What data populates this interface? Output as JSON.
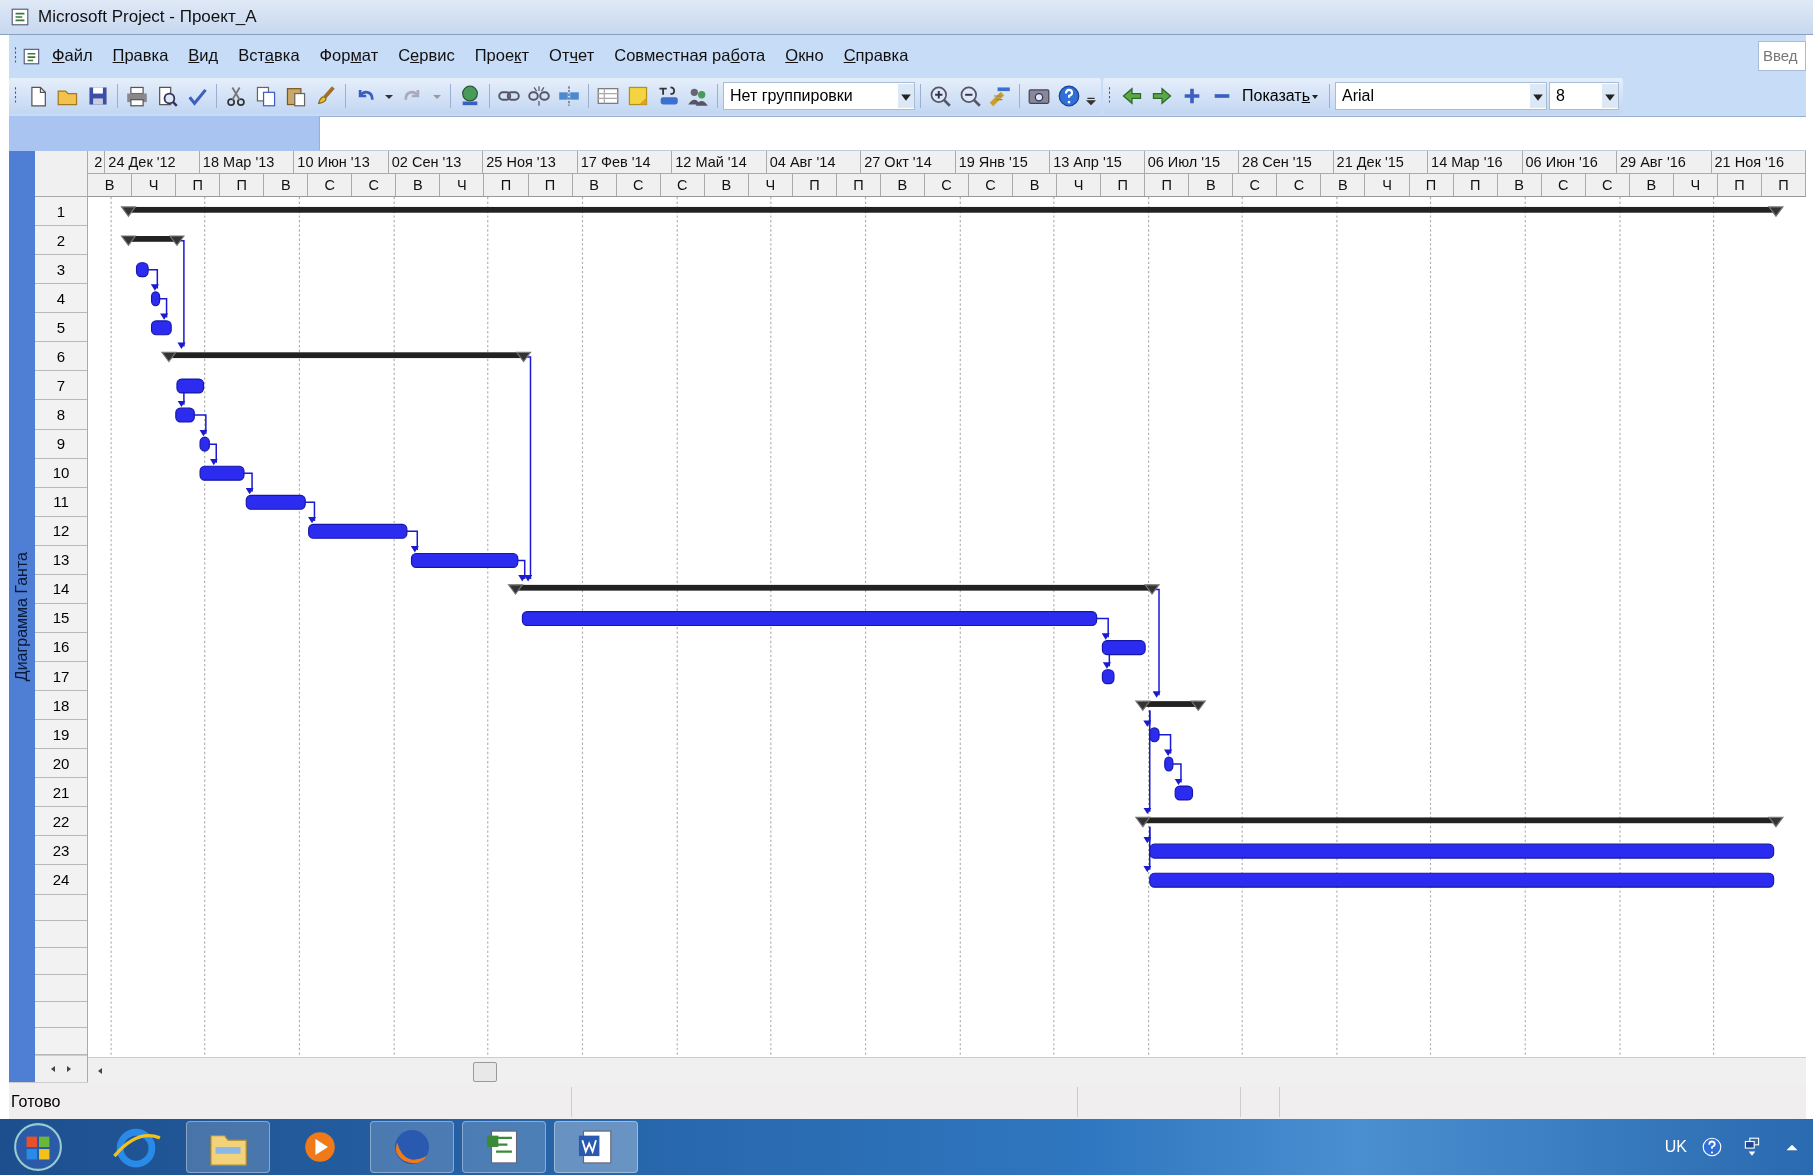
{
  "window": {
    "title": "Microsoft Project - Проект_А"
  },
  "menu": [
    {
      "key": "Ф",
      "post": "айл"
    },
    {
      "key": "П",
      "post": "равка"
    },
    {
      "key": "В",
      "post": "ид"
    },
    {
      "pre": "Вст",
      "key": "а",
      "post": "вка"
    },
    {
      "pre": "Фор",
      "key": "м",
      "post": "ат"
    },
    {
      "pre": "С",
      "key": "е",
      "post": "рвис"
    },
    {
      "pre": "Прое",
      "key": "к",
      "post": "т"
    },
    {
      "pre": "От",
      "key": "ч",
      "post": "ет"
    },
    {
      "pre": "Совместная ра",
      "key": "б",
      "post": "ота"
    },
    {
      "key": "О",
      "post": "кно"
    },
    {
      "key": "С",
      "post": "правка"
    }
  ],
  "help_search": {
    "placeholder": "Введ"
  },
  "toolbar": {
    "grouping": "Нет группировки",
    "show": {
      "pre": "Показат",
      "key": "ь"
    },
    "font": "Arial",
    "font_size": "8"
  },
  "view_bar": {
    "label": "Диаграмма Ганта"
  },
  "timescale": {
    "major": [
      "2",
      "24 Дек '12",
      "18 Мар '13",
      "10 Июн '13",
      "02 Сен '13",
      "25 Ноя '13",
      "17 Фев '14",
      "12 Май '14",
      "04 Авг '14",
      "27 Окт '14",
      "19 Янв '15",
      "13 Апр '15",
      "06 Июл '15",
      "28 Сен '15",
      "21 Дек '15",
      "14 Мар '16",
      "06 Июн '16",
      "29 Авг '16",
      "21 Ноя '16"
    ],
    "minor": [
      "В",
      "Ч",
      "П",
      "П",
      "В",
      "С",
      "С",
      "В",
      "Ч",
      "П",
      "П",
      "В",
      "С",
      "С",
      "В",
      "Ч",
      "П",
      "П",
      "В",
      "С",
      "С",
      "В",
      "Ч",
      "П",
      "П",
      "В",
      "С",
      "С",
      "В",
      "Ч",
      "П",
      "П",
      "В",
      "С",
      "С",
      "В",
      "Ч",
      "П",
      "П"
    ]
  },
  "rows": [
    {
      "number": "1",
      "kind": "summary"
    },
    {
      "number": "2",
      "kind": "summary"
    },
    {
      "number": "3",
      "kind": "task"
    },
    {
      "number": "4",
      "kind": "task"
    },
    {
      "number": "5",
      "kind": "task"
    },
    {
      "number": "6",
      "kind": "summary"
    },
    {
      "number": "7",
      "kind": "task"
    },
    {
      "number": "8",
      "kind": "task"
    },
    {
      "number": "9",
      "kind": "task"
    },
    {
      "number": "10",
      "kind": "task"
    },
    {
      "number": "11",
      "kind": "task"
    },
    {
      "number": "12",
      "kind": "task"
    },
    {
      "number": "13",
      "kind": "task"
    },
    {
      "number": "14",
      "kind": "summary"
    },
    {
      "number": "15",
      "kind": "task"
    },
    {
      "number": "16",
      "kind": "task"
    },
    {
      "number": "17",
      "kind": "task"
    },
    {
      "number": "18",
      "kind": "summary"
    },
    {
      "number": "19",
      "kind": "task"
    },
    {
      "number": "20",
      "kind": "task"
    },
    {
      "number": "21",
      "kind": "task"
    },
    {
      "number": "22",
      "kind": "summary"
    },
    {
      "number": "23",
      "kind": "task"
    },
    {
      "number": "24",
      "kind": "task"
    }
  ],
  "status_bar": {
    "text": "Готово"
  },
  "taskbar": {
    "language": "UK"
  }
}
